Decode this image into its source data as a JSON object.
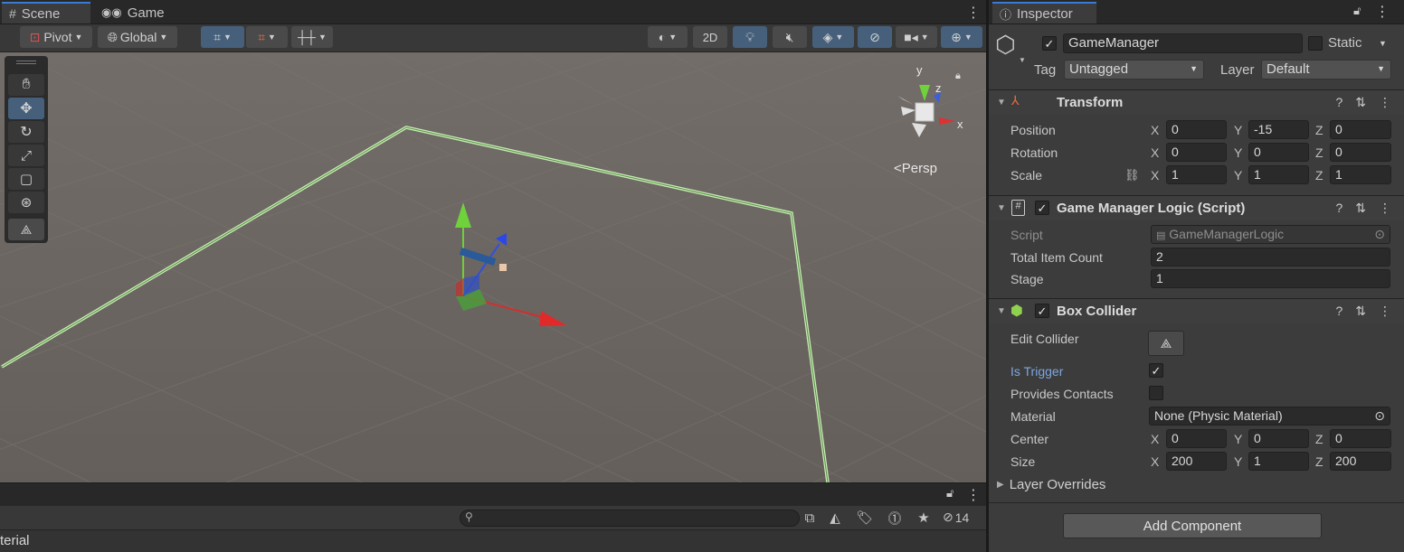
{
  "tabs": {
    "scene": "Scene",
    "game": "Game",
    "inspector": "Inspector"
  },
  "scene_toolbar": {
    "pivot": "Pivot",
    "global": "Global",
    "mode_2d": "2D"
  },
  "gizmo": {
    "y": "y",
    "z": "z",
    "x": "x",
    "persp": "Persp"
  },
  "inspector": {
    "object_name": "GameManager",
    "static_label": "Static",
    "tag_label": "Tag",
    "tag_value": "Untagged",
    "layer_label": "Layer",
    "layer_value": "Default",
    "transform": {
      "title": "Transform",
      "position_label": "Position",
      "rotation_label": "Rotation",
      "scale_label": "Scale",
      "position": {
        "x": "0",
        "y": "-15",
        "z": "0"
      },
      "rotation": {
        "x": "0",
        "y": "0",
        "z": "0"
      },
      "scale": {
        "x": "1",
        "y": "1",
        "z": "1"
      }
    },
    "script_comp": {
      "title": "Game Manager Logic (Script)",
      "script_label": "Script",
      "script_value": "GameManagerLogic",
      "total_label": "Total Item Count",
      "total_value": "2",
      "stage_label": "Stage",
      "stage_value": "1"
    },
    "box_collider": {
      "title": "Box Collider",
      "edit_label": "Edit Collider",
      "trigger_label": "Is Trigger",
      "contacts_label": "Provides Contacts",
      "material_label": "Material",
      "material_value": "None (Physic Material)",
      "center_label": "Center",
      "size_label": "Size",
      "center": {
        "x": "0",
        "y": "0",
        "z": "0"
      },
      "size": {
        "x": "200",
        "y": "1",
        "z": "200"
      },
      "overrides_label": "Layer Overrides"
    },
    "axis": {
      "x": "X",
      "y": "Y",
      "z": "Z"
    },
    "add_component": "Add Component"
  },
  "bottom": {
    "hidden_count": "14",
    "cut_text": "terial",
    "search_placeholder": ""
  },
  "colors": {
    "accent": "#3a7bd5",
    "link_blue": "#7ea6e0",
    "selected": "#46607c"
  }
}
